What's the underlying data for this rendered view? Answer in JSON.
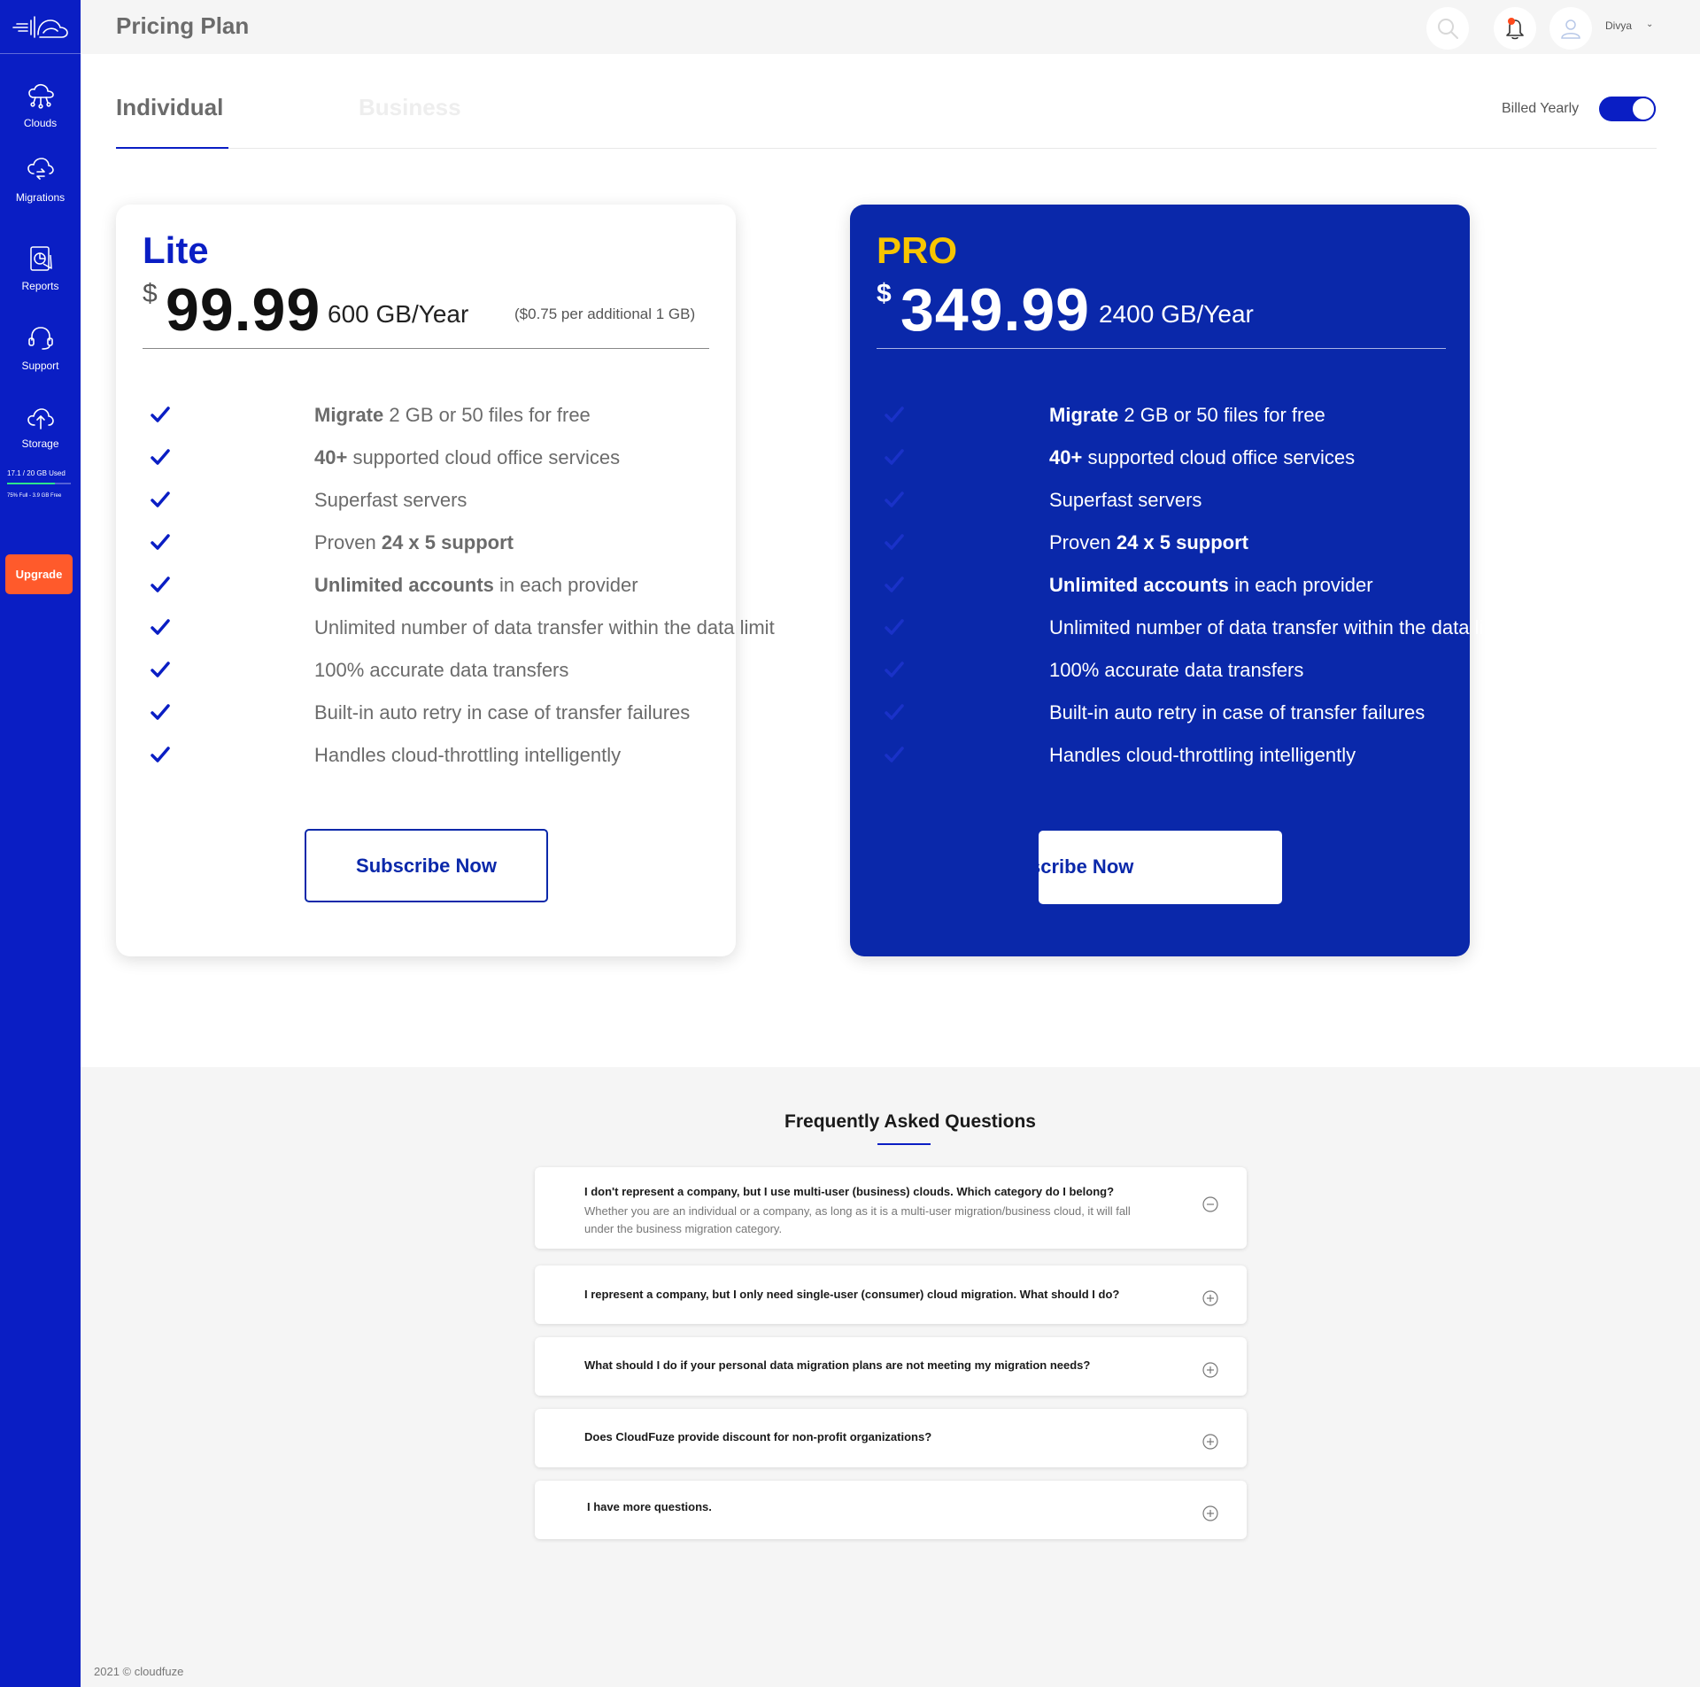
{
  "sidebar": {
    "logo_icon": "cloudfuze-logo",
    "items": [
      {
        "label": "Clouds",
        "icon": "cloud-network-icon"
      },
      {
        "label": "Migrations",
        "icon": "cloud-sync-icon"
      },
      {
        "label": "Reports",
        "icon": "report-chart-icon"
      },
      {
        "label": "Support",
        "icon": "headset-icon"
      },
      {
        "label": "Storage",
        "icon": "cloud-upload-icon"
      }
    ],
    "storage": {
      "used_text": "17.1 / 20 GB Used",
      "free_text": "75% Full - 3.9 GB Free",
      "used_fraction": 0.75
    },
    "upgrade_label": "Upgrade"
  },
  "header": {
    "title": "Pricing Plan",
    "user_name": "Divya",
    "caret": "⌄"
  },
  "tabs": {
    "individual": "Individual",
    "business": "Business",
    "active": "Individual"
  },
  "billing": {
    "label": "Billed Yearly",
    "enabled": true
  },
  "plans": {
    "lite": {
      "name": "Lite",
      "currency": "$",
      "price": "99.99",
      "quota": "600 GB/Year",
      "additional": "($0.75 per additional 1 GB)",
      "button": "Subscribe Now"
    },
    "pro": {
      "name": "PRO",
      "currency": "$",
      "price": "349.99",
      "quota": "2400 GB/Year",
      "button": "scribe Now"
    },
    "features": [
      {
        "bold": "Migrate",
        "rest": " 2 GB or 50 files for free"
      },
      {
        "bold": "40+",
        "rest": " supported cloud office services"
      },
      {
        "plain": "Superfast servers"
      },
      {
        "pre": "Proven ",
        "bold": "24 x 5 support"
      },
      {
        "bold": "Unlimited accounts",
        "rest": " in each provider"
      },
      {
        "plain": "Unlimited number of data transfer within the data limit"
      },
      {
        "plain": "100% accurate data transfers"
      },
      {
        "plain": "Built-in auto retry in case of transfer failures"
      },
      {
        "plain": "Handles cloud-throttling intelligently"
      }
    ]
  },
  "faq": {
    "title": "Frequently Asked Questions",
    "items": [
      {
        "q": "I don't represent a company, but I use multi-user (business) clouds. Which category do I belong?",
        "a": "Whether you are an individual or a company, as long as it is a multi-user migration/business cloud, it will fall under the business migration category.",
        "expanded": true
      },
      {
        "q": "I represent a company, but I only need single-user (consumer) cloud migration. What should I do?",
        "expanded": false
      },
      {
        "q": "What should I do if your personal data migration plans are not meeting my migration needs?",
        "expanded": false
      },
      {
        "q": "Does CloudFuze provide discount for non-profit organizations?",
        "expanded": false
      },
      {
        "q": "I have more questions.",
        "expanded": false
      }
    ]
  },
  "footer": {
    "text": "2021 © cloudfuze"
  },
  "colors": {
    "brand_blue": "#0a1ec4",
    "pro_card": "#0a28aa",
    "pro_accent": "#f7c500",
    "upgrade": "#ff5a2b",
    "storage_fill": "#2ee28c"
  }
}
